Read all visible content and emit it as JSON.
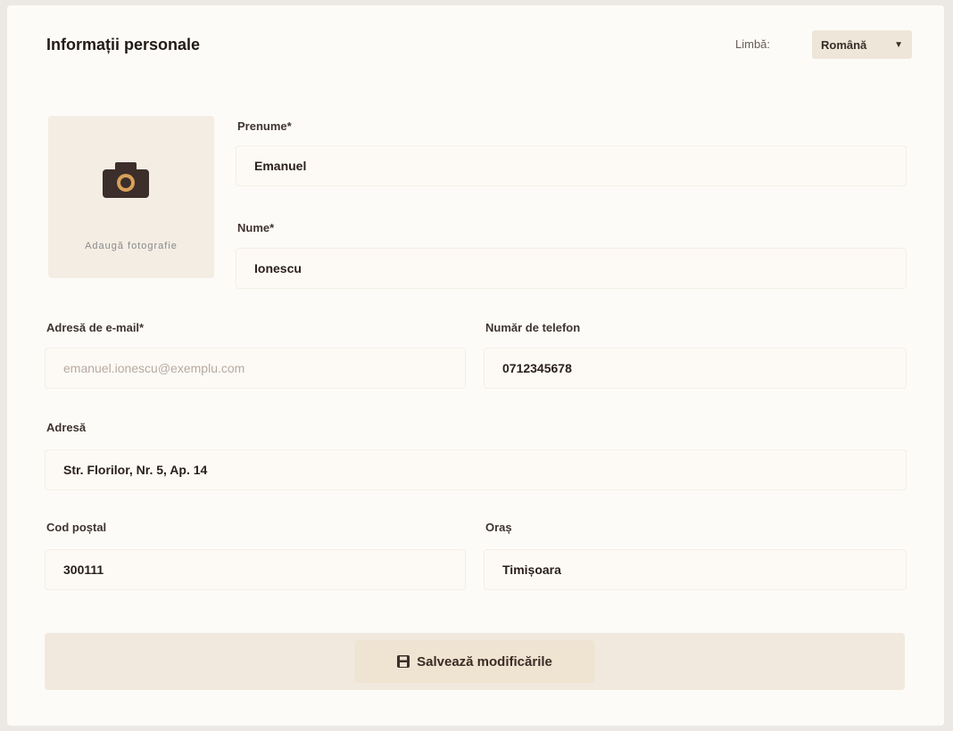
{
  "header": {
    "title": "Informații personale",
    "language_label": "Limbă:",
    "language_selected": "Română"
  },
  "photo": {
    "caption": "Adaugă fotografie",
    "icon": "camera-icon"
  },
  "fields": {
    "first_name": {
      "label": "Prenume*",
      "value": "Emanuel"
    },
    "last_name": {
      "label": "Nume*",
      "value": "Ionescu"
    },
    "email": {
      "label": "Adresă de e-mail*",
      "value": "emanuel.ionescu@exemplu.com"
    },
    "phone": {
      "label": "Număr de telefon",
      "value": "0712345678"
    },
    "address": {
      "label": "Adresă",
      "value": "Str. Florilor, Nr. 5, Ap. 14"
    },
    "postal_code": {
      "label": "Cod poștal",
      "value": "300111"
    },
    "city": {
      "label": "Oraș",
      "value": "Timișoara"
    }
  },
  "actions": {
    "save_label": "Salvează modificările",
    "save_icon": "save-icon"
  },
  "colors": {
    "background": "#fdfbf8",
    "accent": "#efe3d2",
    "text": "#2a201c"
  }
}
